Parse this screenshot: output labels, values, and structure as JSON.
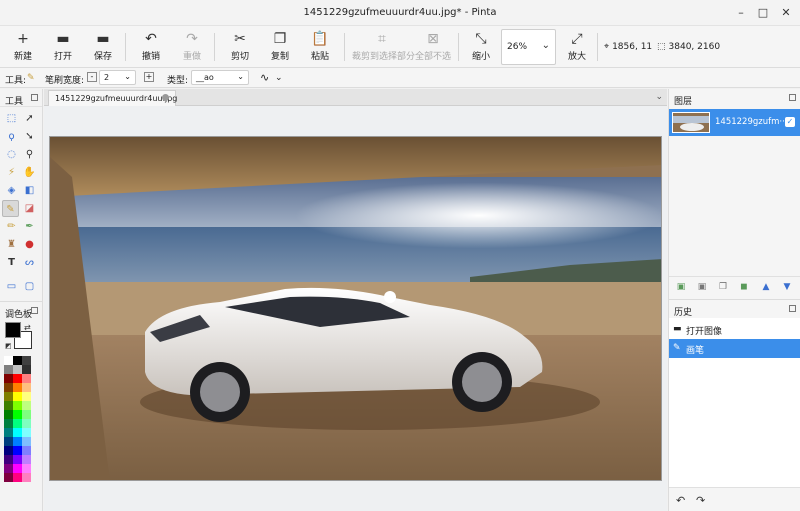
{
  "window": {
    "title": "1451229gzufmeuuurdr4uu.jpg* - Pinta",
    "controls": {
      "minimize": "–",
      "maximize": "□",
      "close": "✕"
    }
  },
  "toolbar": {
    "new": {
      "label": "新建",
      "icon": "+"
    },
    "open": {
      "label": "打开",
      "icon": "▬"
    },
    "save": {
      "label": "保存",
      "icon": "▬"
    },
    "undo": {
      "label": "撤销",
      "icon": "↶"
    },
    "redo": {
      "label": "重做",
      "icon": "↷"
    },
    "cut": {
      "label": "剪切",
      "icon": "✂"
    },
    "copy": {
      "label": "复制",
      "icon": "❐"
    },
    "paste": {
      "label": "粘贴",
      "icon": "📋"
    },
    "crop": {
      "label": "裁剪到选择部分",
      "icon": "⌗"
    },
    "deselect": {
      "label": "全部不选",
      "icon": "⊠"
    },
    "zoom_out": {
      "label": "缩小",
      "icon": "⤡"
    },
    "zoom_value": "26%",
    "zoom_in": {
      "label": "放大",
      "icon": "⤢"
    },
    "cursor_pos": "1856, 11",
    "image_size": "3840, 2160"
  },
  "options": {
    "tool_label": "工具:",
    "brush_width_label": "笔刷宽度:",
    "brush_width_value": "2",
    "type_label": "类型:",
    "type_value": "__ao"
  },
  "tools_panel": {
    "title": "工具"
  },
  "palette_panel": {
    "title": "调色板",
    "primary": "#000000",
    "secondary": "#ffffff",
    "swatches": [
      [
        "#ffffff",
        "#000000",
        "#404040"
      ],
      [
        "#808080",
        "#c0c0c0",
        "#303030"
      ],
      [
        "#7f0000",
        "#ff0000",
        "#ff7f7f"
      ],
      [
        "#7f3f00",
        "#ff7f00",
        "#ffbf7f"
      ],
      [
        "#7f7f00",
        "#ffff00",
        "#ffff7f"
      ],
      [
        "#3f7f00",
        "#7fff00",
        "#bfff7f"
      ],
      [
        "#007f00",
        "#00ff00",
        "#7fff7f"
      ],
      [
        "#007f3f",
        "#00ff7f",
        "#7fffbf"
      ],
      [
        "#007f7f",
        "#00ffff",
        "#7fffff"
      ],
      [
        "#003f7f",
        "#007fff",
        "#7fbfff"
      ],
      [
        "#00007f",
        "#0000ff",
        "#7f7fff"
      ],
      [
        "#3f007f",
        "#7f00ff",
        "#bf7fff"
      ],
      [
        "#7f007f",
        "#ff00ff",
        "#ff7fff"
      ],
      [
        "#7f003f",
        "#ff007f",
        "#ff7fbf"
      ]
    ]
  },
  "document": {
    "tab_label": "1451229gzufmeuuurdr4uu.jpg"
  },
  "layers_panel": {
    "title": "图层",
    "layer_name": "1451229gzufm···",
    "visible_check": "✓"
  },
  "history_panel": {
    "title": "历史",
    "items": [
      {
        "label": "打开图像",
        "icon": "▬"
      },
      {
        "label": "画笔",
        "icon": "✎"
      }
    ],
    "undo_icon": "↶",
    "redo_icon": "↷"
  }
}
